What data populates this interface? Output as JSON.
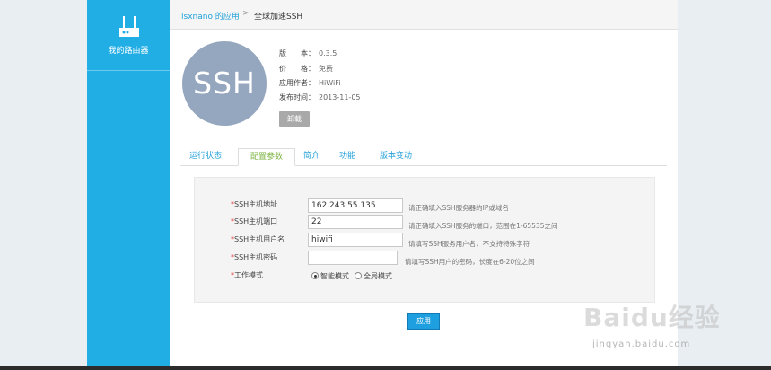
{
  "sidebar": {
    "label": "我的路由器",
    "icon": "router-icon"
  },
  "breadcrumb": {
    "home": "lsxnano 的应用",
    "separator": ">",
    "current": "全球加速SSH"
  },
  "app": {
    "logo_text": "SSH",
    "version_label": "版　　本：",
    "version": "0.3.5",
    "price_label": "价　　格：",
    "price": "免费",
    "author_label": "应用作者：",
    "author": "HiWiFi",
    "date_label": "发布时间：",
    "date": "2013-11-05",
    "uninstall": "卸载"
  },
  "tabs": [
    "运行状态",
    "配置参数",
    "简介",
    "功能",
    "版本变动"
  ],
  "form": {
    "host": {
      "label": "SSH主机地址",
      "value": "162.243.55.135",
      "hint": "请正确填入SSH服务器的IP或域名"
    },
    "port": {
      "label": "SSH主机端口",
      "value": "22",
      "hint": "请正确填入SSH服务的端口，范围在1-65535之间"
    },
    "user": {
      "label": "SSH主机用户名",
      "value": "hiwifi",
      "hint": "请填写SSH服务用户名，不支持特殊字符"
    },
    "pass": {
      "label": "SSH主机密码",
      "value": "",
      "hint": "请填写SSH用户的密码，长度在6-20位之间"
    },
    "mode": {
      "label": "工作模式",
      "option_smart": "智能模式",
      "option_global": "全局模式",
      "selected": "智能模式"
    },
    "required_mark": "*"
  },
  "apply": "应用",
  "watermark": {
    "text": "Baidu经验",
    "sub": "jingyan.baidu.com"
  },
  "colors": {
    "sidebar": "#21aee4",
    "link": "#21a0d8",
    "active_tab": "#7cb342",
    "button": "#1e9fdf",
    "logo": "#95a6bf"
  }
}
